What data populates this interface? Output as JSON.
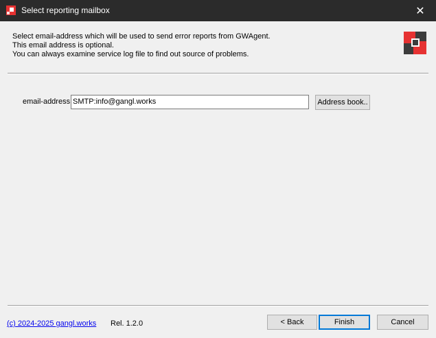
{
  "window": {
    "title": "Select reporting mailbox",
    "close_glyph": "✕",
    "title_bar_color": "#2b2b2b",
    "app_icon": "red-square-app-icon"
  },
  "description": {
    "line1": "Select email-address which will be used to send error reports from GWAgent.",
    "line2": "This email address is optional.",
    "line3": "You can always examine service log file to find out source of problems."
  },
  "logo": {
    "icon": "gwagent-logo-icon",
    "color_red": "#e63232",
    "color_dark": "#3c3c3c"
  },
  "form": {
    "email_label": "email-address:",
    "email_value": "SMTP:info@gangl.works",
    "address_book_label": "Address book.."
  },
  "footer": {
    "copyright_link": "(c) 2024-2025  gangl.works",
    "release": "Rel. 1.2.0",
    "back_label": "< Back",
    "finish_label": "Finish",
    "cancel_label": "Cancel"
  }
}
